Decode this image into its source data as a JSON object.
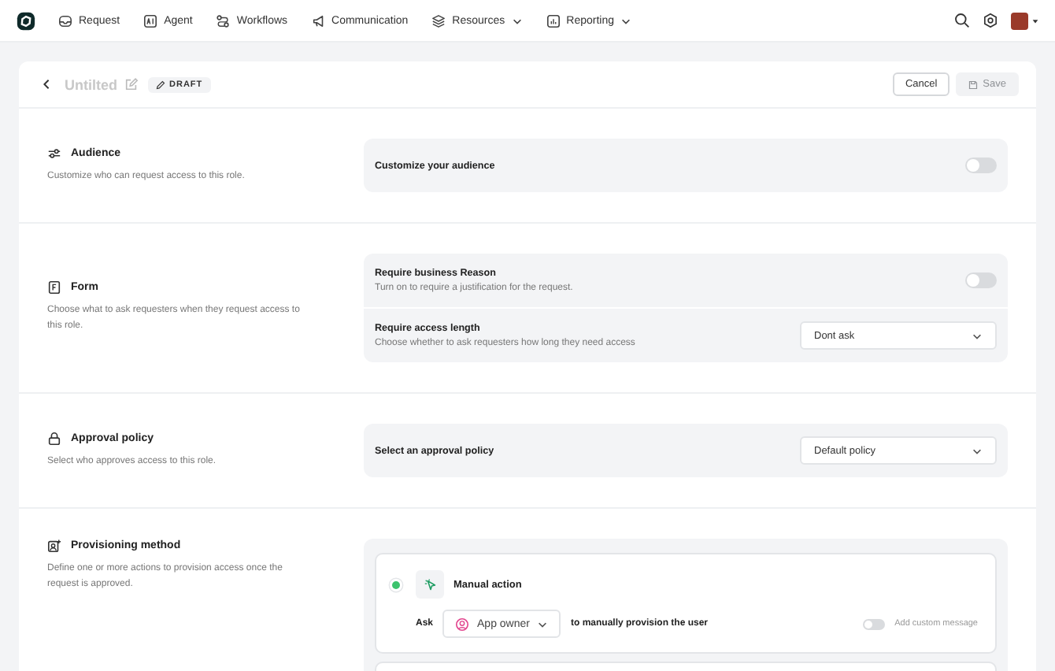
{
  "nav": {
    "items": [
      {
        "label": "Request",
        "dropdown": false
      },
      {
        "label": "Agent",
        "dropdown": false
      },
      {
        "label": "Workflows",
        "dropdown": false
      },
      {
        "label": "Communication",
        "dropdown": false
      },
      {
        "label": "Resources",
        "dropdown": true
      },
      {
        "label": "Reporting",
        "dropdown": true
      }
    ]
  },
  "header": {
    "title": "Untilted",
    "badge": "DRAFT",
    "buttons": [
      {
        "label": "Cancel",
        "kind": "secondary",
        "disabled": false
      },
      {
        "label": "Save",
        "kind": "primary",
        "disabled": true
      }
    ]
  },
  "sections": [
    {
      "title": "Audience",
      "description": "Customize who can request access to this role.",
      "kind": "settings",
      "rows": [
        {
          "kind": "toggle",
          "label": "Customize your audience",
          "on": false
        }
      ]
    },
    {
      "title": "Form",
      "description": "Choose what to ask requesters when they request access to this role.",
      "kind": "settings",
      "rows": [
        {
          "kind": "toggle",
          "label": "Require business Reason",
          "hint": "Turn on to require a justification for the request.",
          "on": false
        },
        {
          "kind": "select",
          "label": "Require access length",
          "hint": "Choose whether to ask requesters how long they need access",
          "value": "Dont ask"
        }
      ]
    },
    {
      "title": "Approval policy",
      "description": "Select who approves access to this role.",
      "kind": "settings",
      "rows": [
        {
          "kind": "select",
          "label": "Select an approval policy",
          "value": "Default policy"
        }
      ]
    },
    {
      "title": "Provisioning method",
      "description": "Define one or more actions to provision access once the request is approved.",
      "kind": "actions",
      "action": {
        "title": "Manual action",
        "ask": "Ask",
        "assignee": "App owner",
        "sentence": "to manually provision the user",
        "custom_message": {
          "label": "Add custom message",
          "on": false
        }
      }
    }
  ]
}
